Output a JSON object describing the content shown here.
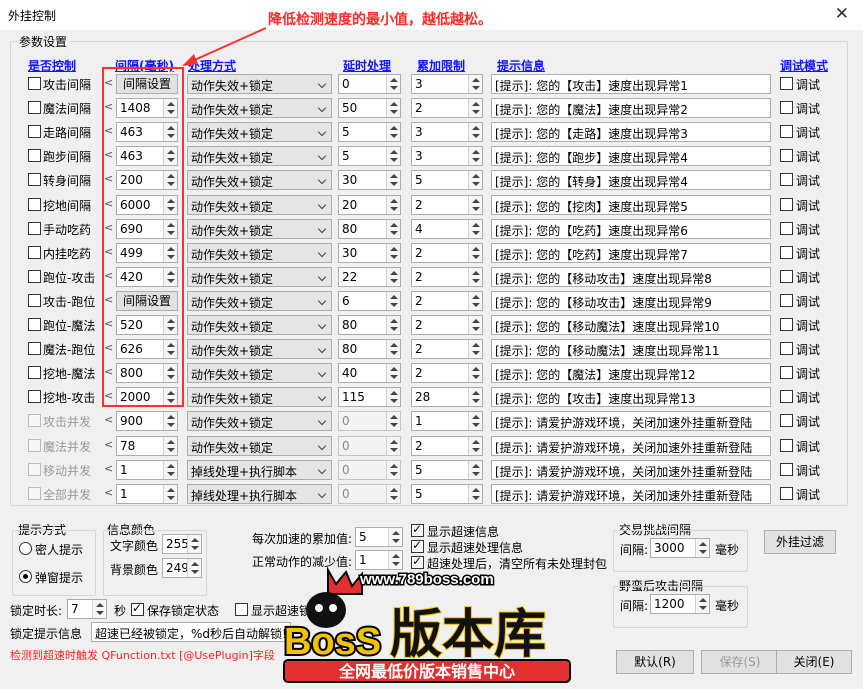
{
  "window": {
    "title": "外挂控制",
    "close_glyph": "✕"
  },
  "annotation": {
    "text": "降低检测速度的最小值，越低越松。"
  },
  "group_params": {
    "label": "参数设置"
  },
  "headers": {
    "enable": "是否控制",
    "interval": "间隔(毫秒)",
    "method": "处理方式",
    "delay": "延时处理",
    "accum": "累加限制",
    "hint": "提示信息",
    "debug": "调试模式"
  },
  "debug_label": "调试",
  "lt_glyph": "<",
  "rows": [
    {
      "name": "攻击间隔",
      "interval": "间隔设置",
      "interval_is_button": true,
      "method": "动作失效+锁定",
      "delay": "0",
      "accum": "3",
      "hint": "[提示]: 您的【攻击】速度出现异常1",
      "disabled": false
    },
    {
      "name": "魔法间隔",
      "interval": "1408",
      "interval_is_button": false,
      "method": "动作失效+锁定",
      "delay": "50",
      "accum": "2",
      "hint": "[提示]: 您的【魔法】速度出现异常2",
      "disabled": false
    },
    {
      "name": "走路间隔",
      "interval": "463",
      "interval_is_button": false,
      "method": "动作失效+锁定",
      "delay": "5",
      "accum": "3",
      "hint": "[提示]: 您的【走路】速度出现异常3",
      "disabled": false
    },
    {
      "name": "跑步间隔",
      "interval": "463",
      "interval_is_button": false,
      "method": "动作失效+锁定",
      "delay": "5",
      "accum": "3",
      "hint": "[提示]: 您的【跑步】速度出现异常4",
      "disabled": false
    },
    {
      "name": "转身间隔",
      "interval": "200",
      "interval_is_button": false,
      "method": "动作失效+锁定",
      "delay": "30",
      "accum": "5",
      "hint": "[提示]: 您的【转身】速度出现异常4",
      "disabled": false
    },
    {
      "name": "挖地间隔",
      "interval": "6000",
      "interval_is_button": false,
      "method": "动作失效+锁定",
      "delay": "20",
      "accum": "2",
      "hint": "[提示]: 您的【挖肉】速度出现异常5",
      "disabled": false
    },
    {
      "name": "手动吃药",
      "interval": "690",
      "interval_is_button": false,
      "method": "动作失效+锁定",
      "delay": "80",
      "accum": "4",
      "hint": "[提示]: 您的【吃药】速度出现异常6",
      "disabled": false
    },
    {
      "name": "内挂吃药",
      "interval": "499",
      "interval_is_button": false,
      "method": "动作失效+锁定",
      "delay": "30",
      "accum": "2",
      "hint": "[提示]: 您的【吃药】速度出现异常7",
      "disabled": false
    },
    {
      "name": "跑位-攻击",
      "interval": "420",
      "interval_is_button": false,
      "method": "动作失效+锁定",
      "delay": "22",
      "accum": "2",
      "hint": "[提示]: 您的【移动攻击】速度出现异常8",
      "disabled": false
    },
    {
      "name": "攻击-跑位",
      "interval": "间隔设置",
      "interval_is_button": true,
      "method": "动作失效+锁定",
      "delay": "6",
      "accum": "2",
      "hint": "[提示]: 您的【移动攻击】速度出现异常9",
      "disabled": false
    },
    {
      "name": "跑位-魔法",
      "interval": "520",
      "interval_is_button": false,
      "method": "动作失效+锁定",
      "delay": "80",
      "accum": "2",
      "hint": "[提示]: 您的【移动魔法】速度出现异常10",
      "disabled": false
    },
    {
      "name": "魔法-跑位",
      "interval": "626",
      "interval_is_button": false,
      "method": "动作失效+锁定",
      "delay": "80",
      "accum": "2",
      "hint": "[提示]: 您的【移动魔法】速度出现异常11",
      "disabled": false
    },
    {
      "name": "挖地-魔法",
      "interval": "800",
      "interval_is_button": false,
      "method": "动作失效+锁定",
      "delay": "40",
      "accum": "2",
      "hint": "[提示]: 您的【魔法】速度出现异常12",
      "disabled": false
    },
    {
      "name": "挖地-攻击",
      "interval": "2000",
      "interval_is_button": false,
      "method": "动作失效+锁定",
      "delay": "115",
      "accum": "28",
      "hint": "[提示]: 您的【攻击】速度出现异常13",
      "disabled": false
    },
    {
      "name": "攻击并发",
      "interval": "900",
      "interval_is_button": false,
      "method": "动作失效+锁定",
      "delay": "0",
      "accum": "1",
      "hint": "[提示]: 请爱护游戏环境，关闭加速外挂重新登陆",
      "disabled": true
    },
    {
      "name": "魔法并发",
      "interval": "78",
      "interval_is_button": false,
      "method": "动作失效+锁定",
      "delay": "0",
      "accum": "2",
      "hint": "[提示]: 请爱护游戏环境，关闭加速外挂重新登陆",
      "disabled": true
    },
    {
      "name": "移动并发",
      "interval": "1",
      "interval_is_button": false,
      "method": "掉线处理+执行脚本",
      "delay": "0",
      "accum": "5",
      "hint": "[提示]: 请爱护游戏环境，关闭加速外挂重新登陆",
      "disabled": true
    },
    {
      "name": "全部并发",
      "interval": "1",
      "interval_is_button": false,
      "method": "掉线处理+执行脚本",
      "delay": "0",
      "accum": "5",
      "hint": "[提示]: 请爱护游戏环境，关闭加速外挂重新登陆",
      "disabled": true
    }
  ],
  "hint_mode": {
    "label": "提示方式",
    "opt1": "密人提示",
    "opt2": "弹窗提示",
    "selected": "弹窗提示"
  },
  "info_color": {
    "label": "信息颜色",
    "text_label": "文字颜色",
    "text_value": "255",
    "bg_label": "背景颜色",
    "bg_value": "249"
  },
  "accel": {
    "accum_label": "每次加速的累加值:",
    "accum_value": "5",
    "normal_label": "正常动作的减少值:",
    "normal_value": "1"
  },
  "options": {
    "show_info": "显示超速信息",
    "show_process_info": "显示超速处理信息",
    "clear_after": "超速处理后，清空所有未处理封包"
  },
  "trade_interval": {
    "label": "交易挑战间隔",
    "field_label": "间隔:",
    "value": "3000",
    "unit": "毫秒"
  },
  "after_attack": {
    "label": "野蛮后攻击间隔",
    "field_label": "间隔:",
    "value": "1200",
    "unit": "毫秒"
  },
  "filter_button": "外挂过滤",
  "lock": {
    "duration_label": "锁定时长:",
    "duration_value": "7",
    "unit": "秒",
    "save_state": "保存锁定状态",
    "show_speed": "显示超速锁"
  },
  "lock_hint": {
    "label": "锁定提示信息",
    "value": "超速已经被锁定，%d秒后自动解锁!"
  },
  "status_line": "检测到超速时触发 QFunction.txt [@UsePlugin]字段",
  "buttons": {
    "default": "默认(R)",
    "save": "保存(S)",
    "close": "关闭(E)"
  },
  "watermark": {
    "url": "www.789boss.com",
    "brand": "BosS",
    "brand_cn": "版本库",
    "slogan": "全网最低价版本销售中心"
  },
  "colors": {
    "header_blue": "#1414ff",
    "annotation_red": "#ff2a2a",
    "watermark_gold": "#f2c200"
  }
}
